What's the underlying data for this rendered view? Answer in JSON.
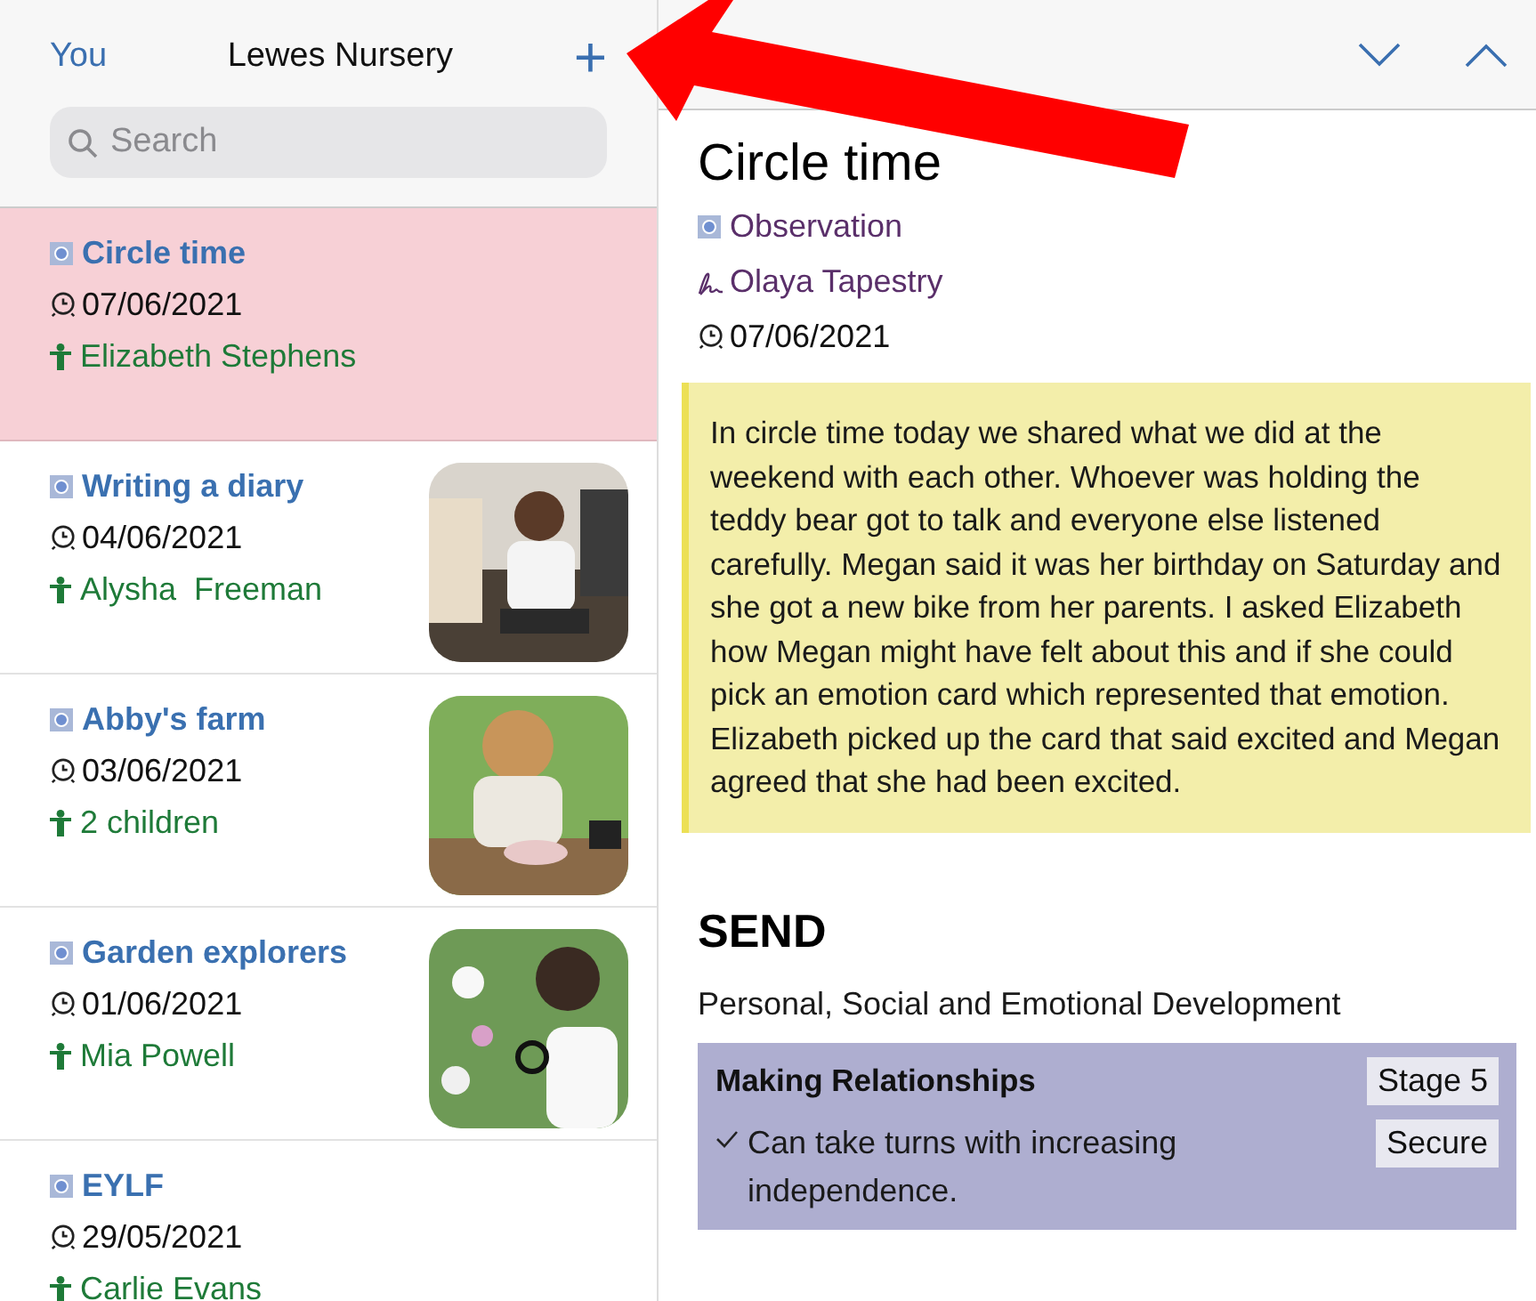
{
  "nav": {
    "back": "You",
    "title": "Lewes Nursery",
    "add": "+"
  },
  "search": {
    "placeholder": "Search"
  },
  "entries": [
    {
      "title": "Circle time",
      "date": "07/06/2021",
      "children": "Elizabeth Stephens",
      "selected": true
    },
    {
      "title": "Writing a diary",
      "date": "04/06/2021",
      "children": "Alysha  Freeman",
      "selected": false
    },
    {
      "title": "Abby's farm",
      "date": "03/06/2021",
      "children": "2 children",
      "selected": false
    },
    {
      "title": "Garden explorers",
      "date": "01/06/2021",
      "children": "Mia Powell",
      "selected": false
    },
    {
      "title": "EYLF",
      "date": "29/05/2021",
      "children": "Carlie Evans",
      "selected": false
    }
  ],
  "detail": {
    "title": "Circle time",
    "type": "Observation",
    "author": "Olaya Tapestry",
    "date": "07/06/2021",
    "note": "In circle time today we shared what we did at the weekend with each other. Whoever was holding the teddy bear got to talk and everyone else listened carefully. Megan said it was her birthday on Saturday and she got a new bike from her parents. I asked Elizabeth how Megan might have felt about this and if she could pick an emotion card which represented that emotion. Elizabeth picked up the card that said excited and Megan agreed that she had been excited.",
    "framework": "SEND",
    "area": "Personal, Social and Emotional Development",
    "aspect": {
      "name": "Making Relationships",
      "stage": "Stage 5",
      "statements": [
        {
          "text": "Can take turns with increasing independence.",
          "checked": true,
          "judgement": "Secure"
        }
      ]
    }
  }
}
